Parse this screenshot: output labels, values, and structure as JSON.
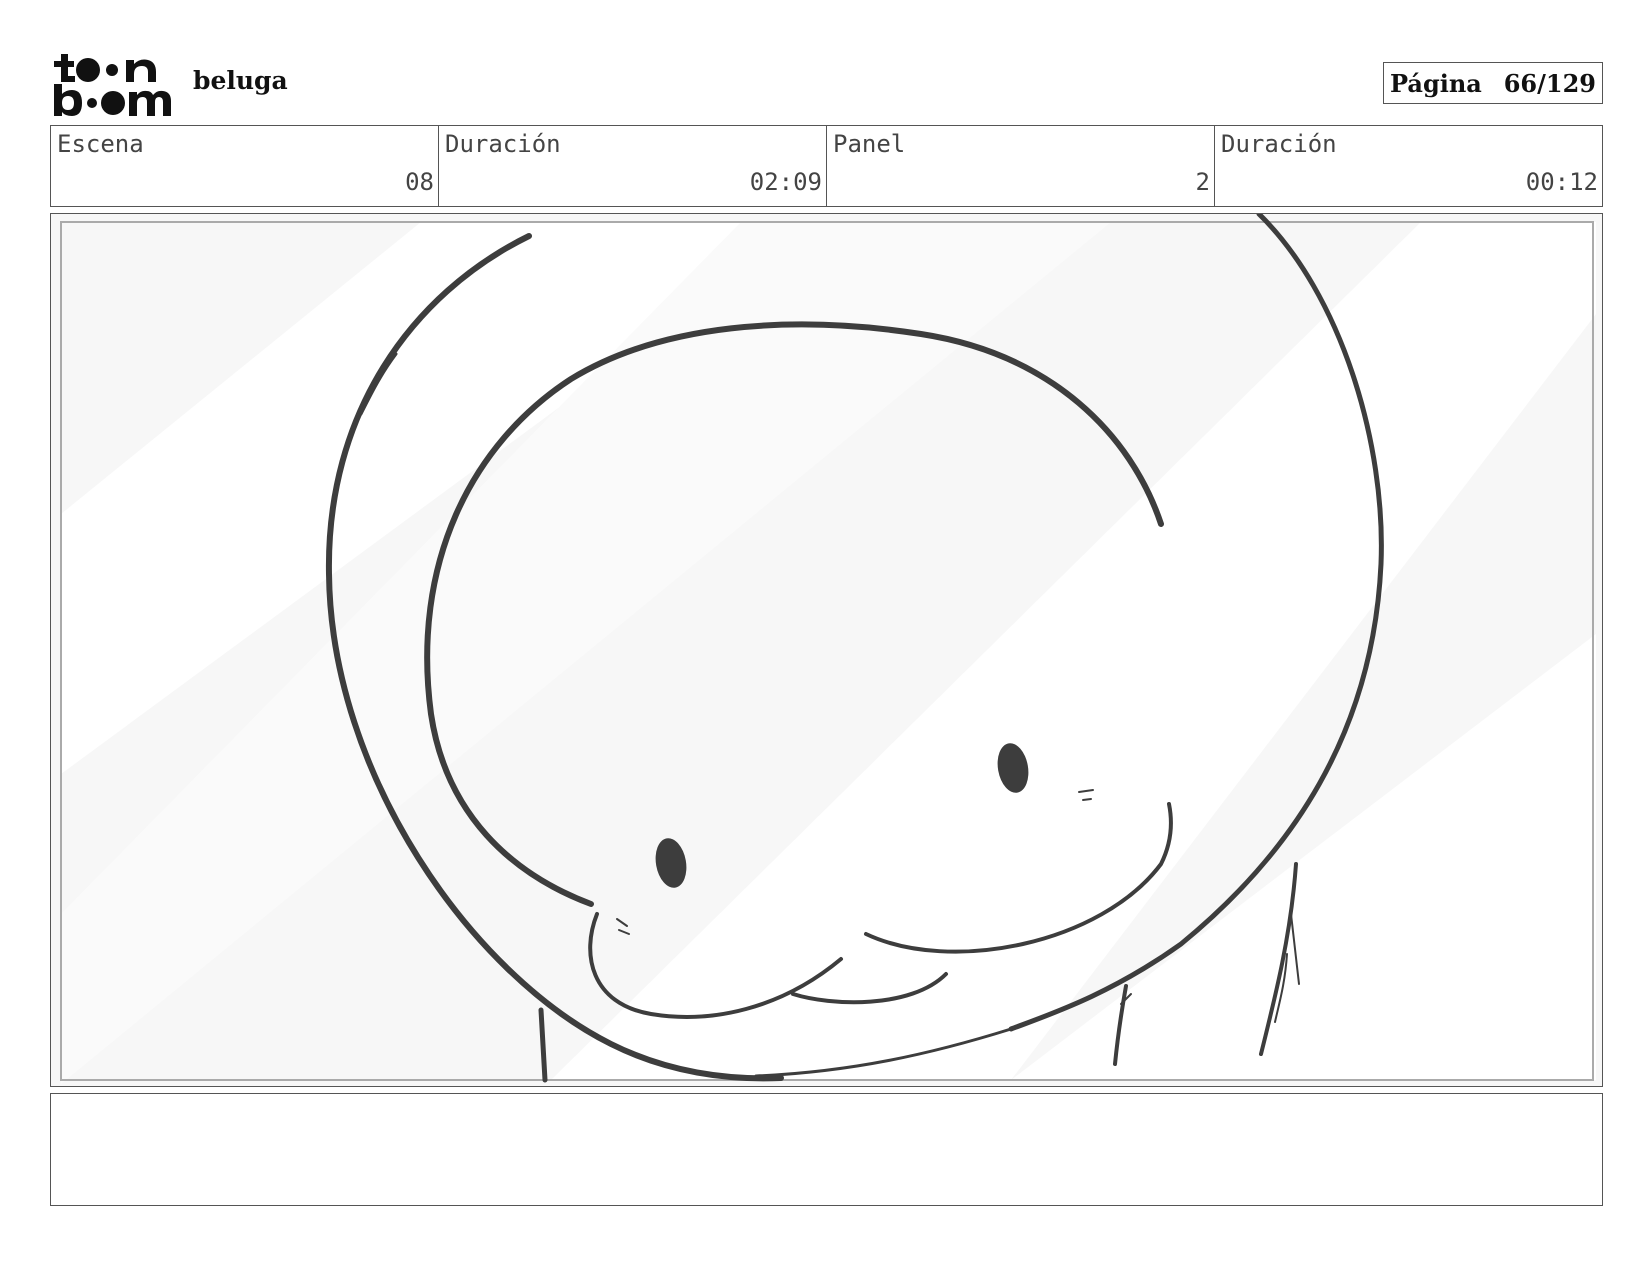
{
  "header": {
    "logo_text": "toon boom",
    "project_title": "beluga",
    "page_label": "Página",
    "page_number": "66/129"
  },
  "info": {
    "scene_label": "Escena",
    "scene_value": "08",
    "scene_duration_label": "Duración",
    "scene_duration_value": "02:09",
    "panel_label": "Panel",
    "panel_value": "2",
    "panel_duration_label": "Duración",
    "panel_duration_value": "00:12"
  },
  "notes": {
    "text": ""
  }
}
